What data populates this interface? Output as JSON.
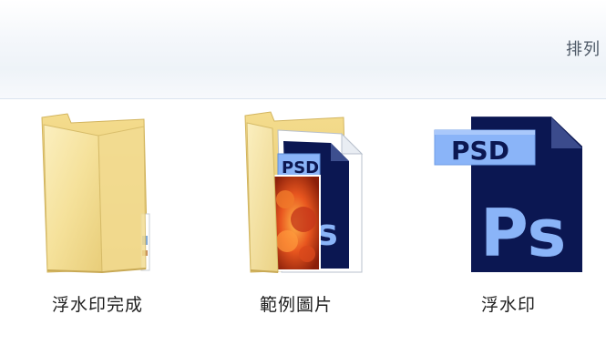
{
  "toolbar": {
    "sort_label": "排列"
  },
  "items": [
    {
      "name": "浮水印完成",
      "type": "folder",
      "icon": "folder-icon"
    },
    {
      "name": "範例圖片",
      "type": "folder",
      "icon": "folder-with-images-icon"
    },
    {
      "name": "浮水印",
      "type": "psd-file",
      "icon": "photoshop-psd-file-icon",
      "badge": "PSD",
      "glyph": "Ps"
    }
  ],
  "colors": {
    "folder_light": "#f9e9a8",
    "folder_dark": "#e2c772",
    "psd_navy": "#0b1752",
    "psd_blue": "#8ab4f8"
  }
}
